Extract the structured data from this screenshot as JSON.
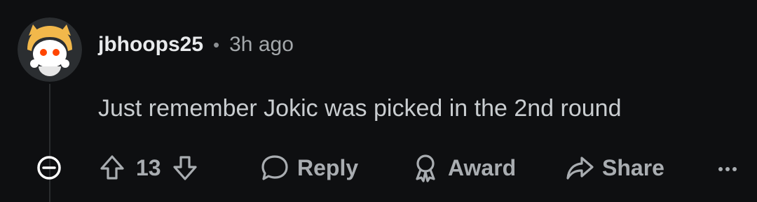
{
  "comment": {
    "username": "jbhoops25",
    "separator": "•",
    "time": "3h ago",
    "text": "Just remember Jokic was picked in the 2nd round"
  },
  "actions": {
    "vote_count": "13",
    "reply_label": "Reply",
    "award_label": "Award",
    "share_label": "Share"
  },
  "icons": {
    "collapse": "collapse-minus-icon",
    "upvote": "upvote-arrow-icon",
    "downvote": "downvote-arrow-icon",
    "reply": "speech-bubble-icon",
    "award": "award-ribbon-icon",
    "share": "share-arrow-icon",
    "more": "more-dots-icon"
  },
  "colors": {
    "background": "#0e0f11",
    "text": "#c9cdd0",
    "muted": "#a9adb1",
    "avatar_hat": "#f2b84b",
    "avatar_eyes": "#ff4500"
  }
}
